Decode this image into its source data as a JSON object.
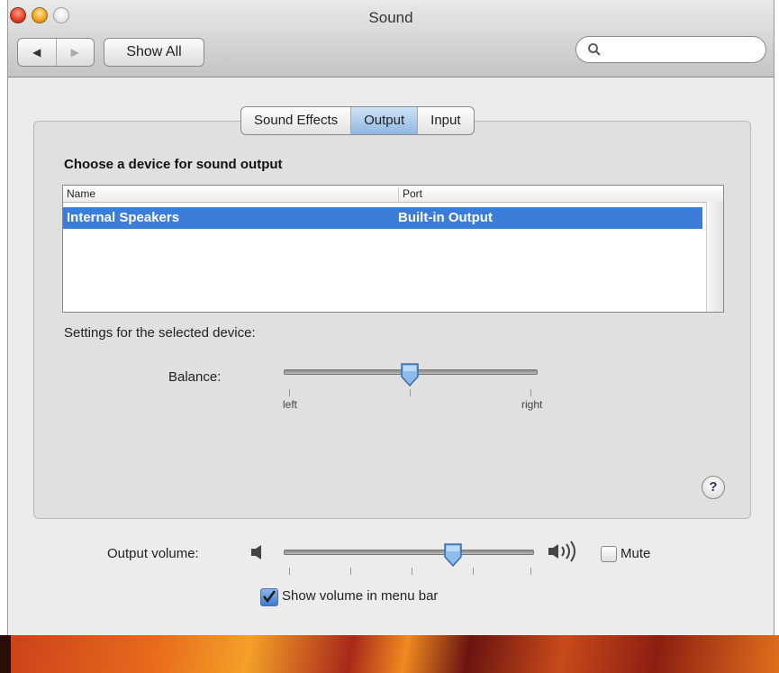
{
  "window": {
    "title": "Sound"
  },
  "toolbar": {
    "back_glyph": "◀",
    "forward_glyph": "▶",
    "show_all_label": "Show All",
    "search_value": ""
  },
  "tabs": [
    {
      "label": "Sound Effects",
      "active": false
    },
    {
      "label": "Output",
      "active": true
    },
    {
      "label": "Input",
      "active": false
    }
  ],
  "output": {
    "heading": "Choose a device for sound output",
    "columns": {
      "name": "Name",
      "port": "Port"
    },
    "devices": [
      {
        "name": "Internal Speakers",
        "port": "Built-in Output",
        "selected": true
      }
    ],
    "settings_label": "Settings for the selected device:",
    "balance": {
      "label": "Balance:",
      "left_label": "left",
      "right_label": "right",
      "value": 0.5
    }
  },
  "volume": {
    "label": "Output volume:",
    "value": 0.68,
    "mute_label": "Mute",
    "mute_checked": false,
    "show_in_menu_bar_label": "Show volume in menu bar",
    "show_in_menu_bar_checked": true
  },
  "help": {
    "glyph": "?"
  },
  "colors": {
    "selection": "#3b7dd8",
    "active_tab": "#8fb7e2"
  }
}
